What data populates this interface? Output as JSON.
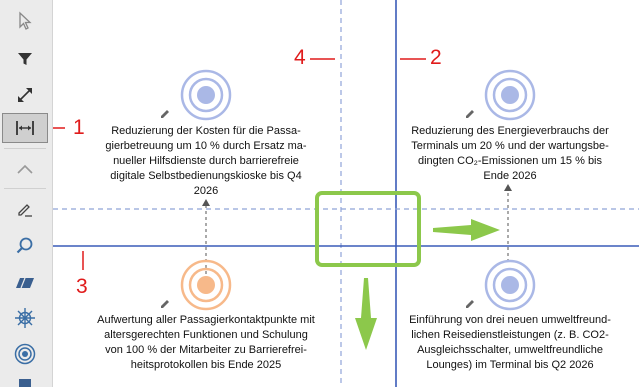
{
  "toolbar": {
    "tools": [
      {
        "name": "select-pointer",
        "icon": "cursor-arrow-icon"
      },
      {
        "name": "filter",
        "icon": "funnel-icon"
      },
      {
        "name": "resize",
        "icon": "diagonal-arrows-icon"
      },
      {
        "name": "distribute",
        "icon": "distribute-horizontal-icon",
        "active": true
      },
      {
        "name": "collapse",
        "icon": "chevron-up-icon"
      },
      {
        "name": "edit",
        "icon": "pencil-line-icon"
      },
      {
        "name": "search",
        "icon": "magnifier-icon"
      },
      {
        "name": "parallelogram",
        "icon": "parallelogram-icon"
      },
      {
        "name": "wheel",
        "icon": "ship-wheel-icon"
      },
      {
        "name": "target",
        "icon": "target-icon"
      }
    ]
  },
  "callouts": {
    "c1": "1",
    "c2": "2",
    "c3": "3",
    "c4": "4"
  },
  "nodes": {
    "top_left": {
      "lines": [
        "Reduzierung der Kosten für die Passa-",
        "gierbetreuung um 10 % durch Ersatz ma-",
        "nueller Hilfsdienste durch barrierefreie",
        "digitale Selbstbedienungskioske bis Q4",
        "2026"
      ],
      "color": "#aab8e6"
    },
    "top_right": {
      "lines": [
        "Reduzierung des Energieverbrauchs der",
        "Terminals um 20 % und der wartungsbe-",
        "dingten CO₂-Emissionen um 15 % bis",
        "Ende 2026"
      ],
      "color": "#aab8e6"
    },
    "bottom_left": {
      "lines": [
        "Aufwertung aller Passagierkontaktpunkte mit",
        "altersgerechten Funktionen und Schulung",
        "von 100 % der Mitarbeiter zu Barrierefrei-",
        "heitsprotokollen bis Ende 2025"
      ],
      "color": "#f7b98a"
    },
    "bottom_right": {
      "lines": [
        "Einführung von drei neuen umweltfreund-",
        "lichen Reisedienstleistungen (z. B. CO2-",
        "Ausgleichsschalter, umweltfreundliche",
        "Lounges) im Terminal bis Q2 2026"
      ],
      "color": "#aab8e6"
    }
  },
  "colors": {
    "solid_line": "#3a5cb8",
    "dashed_line": "#8fa4d8",
    "highlight": "#8cc84b",
    "callout": "#e01b1b"
  }
}
